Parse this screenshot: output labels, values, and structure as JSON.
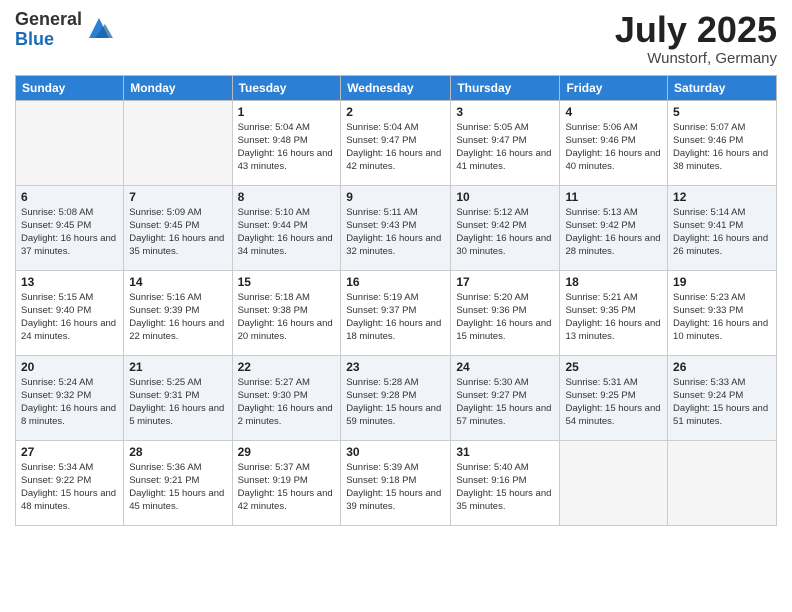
{
  "logo": {
    "general": "General",
    "blue": "Blue"
  },
  "title": "July 2025",
  "location": "Wunstorf, Germany",
  "days_of_week": [
    "Sunday",
    "Monday",
    "Tuesday",
    "Wednesday",
    "Thursday",
    "Friday",
    "Saturday"
  ],
  "weeks": [
    [
      {
        "num": "",
        "sunrise": "",
        "sunset": "",
        "daylight": ""
      },
      {
        "num": "",
        "sunrise": "",
        "sunset": "",
        "daylight": ""
      },
      {
        "num": "1",
        "sunrise": "Sunrise: 5:04 AM",
        "sunset": "Sunset: 9:48 PM",
        "daylight": "Daylight: 16 hours and 43 minutes."
      },
      {
        "num": "2",
        "sunrise": "Sunrise: 5:04 AM",
        "sunset": "Sunset: 9:47 PM",
        "daylight": "Daylight: 16 hours and 42 minutes."
      },
      {
        "num": "3",
        "sunrise": "Sunrise: 5:05 AM",
        "sunset": "Sunset: 9:47 PM",
        "daylight": "Daylight: 16 hours and 41 minutes."
      },
      {
        "num": "4",
        "sunrise": "Sunrise: 5:06 AM",
        "sunset": "Sunset: 9:46 PM",
        "daylight": "Daylight: 16 hours and 40 minutes."
      },
      {
        "num": "5",
        "sunrise": "Sunrise: 5:07 AM",
        "sunset": "Sunset: 9:46 PM",
        "daylight": "Daylight: 16 hours and 38 minutes."
      }
    ],
    [
      {
        "num": "6",
        "sunrise": "Sunrise: 5:08 AM",
        "sunset": "Sunset: 9:45 PM",
        "daylight": "Daylight: 16 hours and 37 minutes."
      },
      {
        "num": "7",
        "sunrise": "Sunrise: 5:09 AM",
        "sunset": "Sunset: 9:45 PM",
        "daylight": "Daylight: 16 hours and 35 minutes."
      },
      {
        "num": "8",
        "sunrise": "Sunrise: 5:10 AM",
        "sunset": "Sunset: 9:44 PM",
        "daylight": "Daylight: 16 hours and 34 minutes."
      },
      {
        "num": "9",
        "sunrise": "Sunrise: 5:11 AM",
        "sunset": "Sunset: 9:43 PM",
        "daylight": "Daylight: 16 hours and 32 minutes."
      },
      {
        "num": "10",
        "sunrise": "Sunrise: 5:12 AM",
        "sunset": "Sunset: 9:42 PM",
        "daylight": "Daylight: 16 hours and 30 minutes."
      },
      {
        "num": "11",
        "sunrise": "Sunrise: 5:13 AM",
        "sunset": "Sunset: 9:42 PM",
        "daylight": "Daylight: 16 hours and 28 minutes."
      },
      {
        "num": "12",
        "sunrise": "Sunrise: 5:14 AM",
        "sunset": "Sunset: 9:41 PM",
        "daylight": "Daylight: 16 hours and 26 minutes."
      }
    ],
    [
      {
        "num": "13",
        "sunrise": "Sunrise: 5:15 AM",
        "sunset": "Sunset: 9:40 PM",
        "daylight": "Daylight: 16 hours and 24 minutes."
      },
      {
        "num": "14",
        "sunrise": "Sunrise: 5:16 AM",
        "sunset": "Sunset: 9:39 PM",
        "daylight": "Daylight: 16 hours and 22 minutes."
      },
      {
        "num": "15",
        "sunrise": "Sunrise: 5:18 AM",
        "sunset": "Sunset: 9:38 PM",
        "daylight": "Daylight: 16 hours and 20 minutes."
      },
      {
        "num": "16",
        "sunrise": "Sunrise: 5:19 AM",
        "sunset": "Sunset: 9:37 PM",
        "daylight": "Daylight: 16 hours and 18 minutes."
      },
      {
        "num": "17",
        "sunrise": "Sunrise: 5:20 AM",
        "sunset": "Sunset: 9:36 PM",
        "daylight": "Daylight: 16 hours and 15 minutes."
      },
      {
        "num": "18",
        "sunrise": "Sunrise: 5:21 AM",
        "sunset": "Sunset: 9:35 PM",
        "daylight": "Daylight: 16 hours and 13 minutes."
      },
      {
        "num": "19",
        "sunrise": "Sunrise: 5:23 AM",
        "sunset": "Sunset: 9:33 PM",
        "daylight": "Daylight: 16 hours and 10 minutes."
      }
    ],
    [
      {
        "num": "20",
        "sunrise": "Sunrise: 5:24 AM",
        "sunset": "Sunset: 9:32 PM",
        "daylight": "Daylight: 16 hours and 8 minutes."
      },
      {
        "num": "21",
        "sunrise": "Sunrise: 5:25 AM",
        "sunset": "Sunset: 9:31 PM",
        "daylight": "Daylight: 16 hours and 5 minutes."
      },
      {
        "num": "22",
        "sunrise": "Sunrise: 5:27 AM",
        "sunset": "Sunset: 9:30 PM",
        "daylight": "Daylight: 16 hours and 2 minutes."
      },
      {
        "num": "23",
        "sunrise": "Sunrise: 5:28 AM",
        "sunset": "Sunset: 9:28 PM",
        "daylight": "Daylight: 15 hours and 59 minutes."
      },
      {
        "num": "24",
        "sunrise": "Sunrise: 5:30 AM",
        "sunset": "Sunset: 9:27 PM",
        "daylight": "Daylight: 15 hours and 57 minutes."
      },
      {
        "num": "25",
        "sunrise": "Sunrise: 5:31 AM",
        "sunset": "Sunset: 9:25 PM",
        "daylight": "Daylight: 15 hours and 54 minutes."
      },
      {
        "num": "26",
        "sunrise": "Sunrise: 5:33 AM",
        "sunset": "Sunset: 9:24 PM",
        "daylight": "Daylight: 15 hours and 51 minutes."
      }
    ],
    [
      {
        "num": "27",
        "sunrise": "Sunrise: 5:34 AM",
        "sunset": "Sunset: 9:22 PM",
        "daylight": "Daylight: 15 hours and 48 minutes."
      },
      {
        "num": "28",
        "sunrise": "Sunrise: 5:36 AM",
        "sunset": "Sunset: 9:21 PM",
        "daylight": "Daylight: 15 hours and 45 minutes."
      },
      {
        "num": "29",
        "sunrise": "Sunrise: 5:37 AM",
        "sunset": "Sunset: 9:19 PM",
        "daylight": "Daylight: 15 hours and 42 minutes."
      },
      {
        "num": "30",
        "sunrise": "Sunrise: 5:39 AM",
        "sunset": "Sunset: 9:18 PM",
        "daylight": "Daylight: 15 hours and 39 minutes."
      },
      {
        "num": "31",
        "sunrise": "Sunrise: 5:40 AM",
        "sunset": "Sunset: 9:16 PM",
        "daylight": "Daylight: 15 hours and 35 minutes."
      },
      {
        "num": "",
        "sunrise": "",
        "sunset": "",
        "daylight": ""
      },
      {
        "num": "",
        "sunrise": "",
        "sunset": "",
        "daylight": ""
      }
    ]
  ]
}
